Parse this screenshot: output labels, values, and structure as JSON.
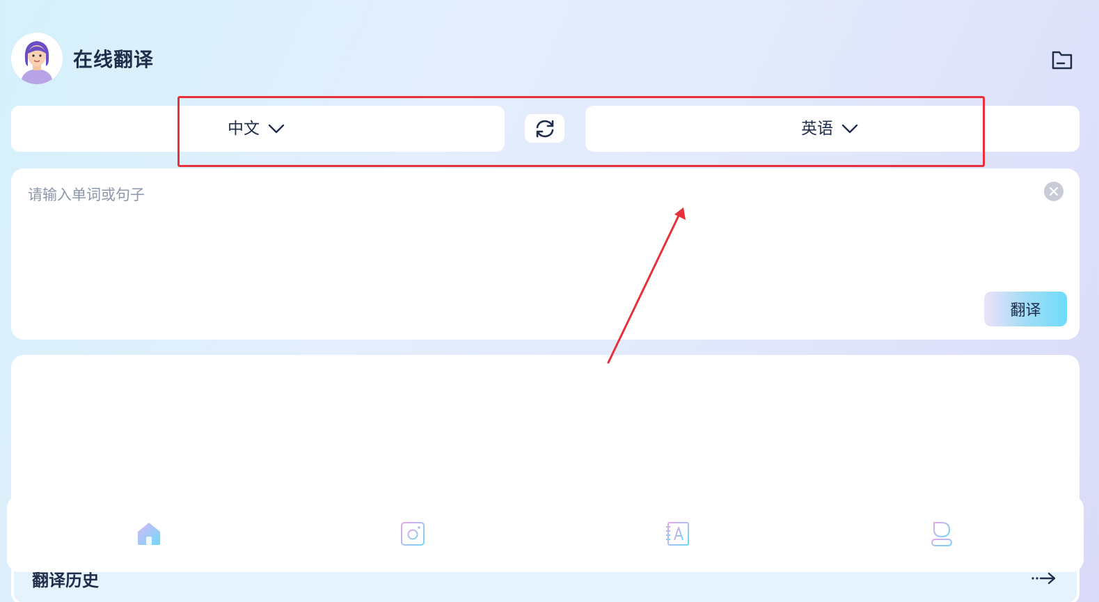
{
  "header": {
    "title": "在线翻译",
    "avatar_icon": "person-avatar",
    "folder_icon": "folder-icon"
  },
  "languages": {
    "source": "中文",
    "target": "英语",
    "swap_icon": "swap-refresh-icon"
  },
  "input": {
    "placeholder": "请输入单词或句子",
    "value": "",
    "clear_icon": "close-icon",
    "translate_label": "翻译"
  },
  "output": {
    "text": ""
  },
  "history": {
    "title": "翻译历史",
    "more_icon": "arrow-right-icon"
  },
  "nav": {
    "items": [
      {
        "icon": "home-icon",
        "active": true
      },
      {
        "icon": "camera-icon",
        "active": false
      },
      {
        "icon": "dictionary-icon",
        "active": false
      },
      {
        "icon": "profile-icon",
        "active": false
      }
    ]
  },
  "annotation": {
    "highlight_color": "#e8303b"
  },
  "colors": {
    "text": "#1f2d4a",
    "placeholder": "#8e97a8",
    "accent_gradient_start": "#ece2f9",
    "accent_gradient_end": "#6ddcfb"
  }
}
